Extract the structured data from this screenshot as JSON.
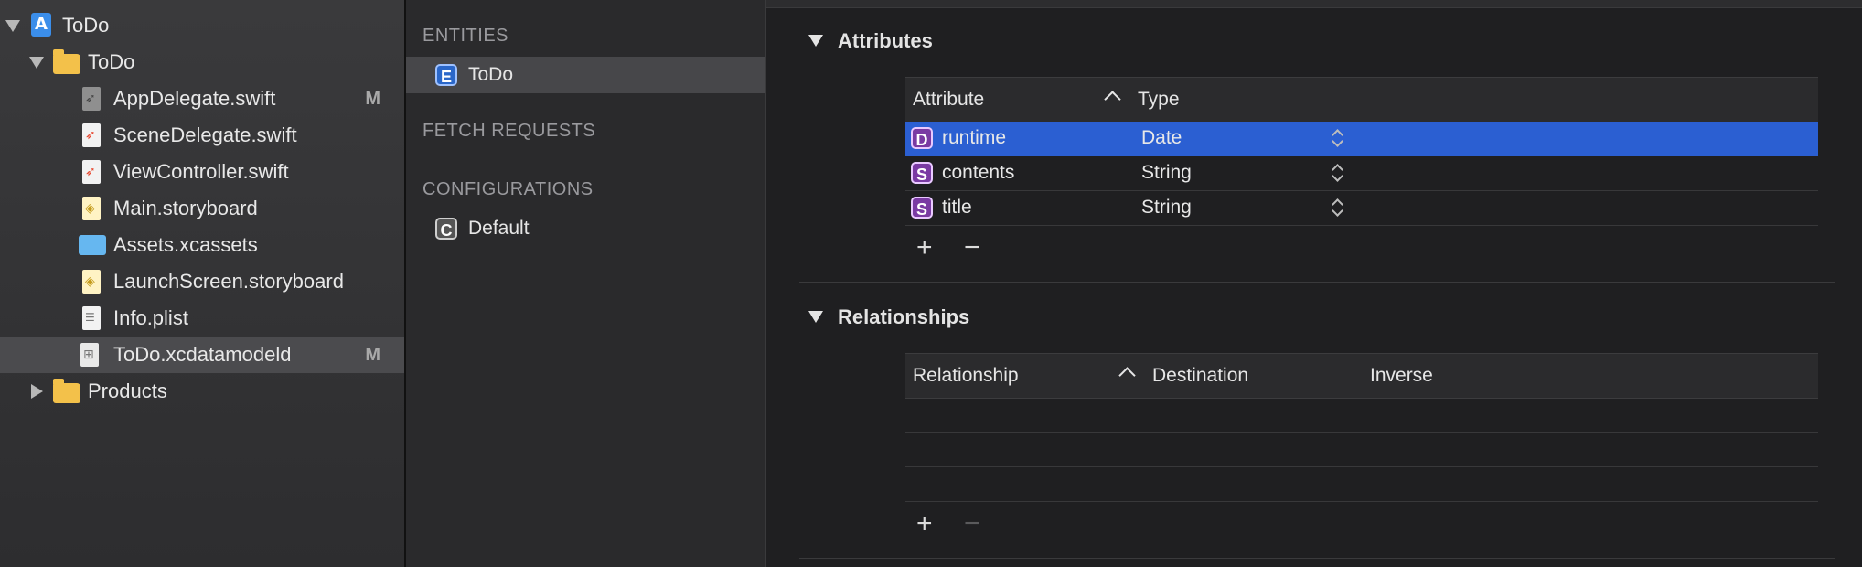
{
  "navigator": {
    "items": [
      {
        "label": "ToDo",
        "badge": "",
        "icon": "project-icon"
      },
      {
        "label": "ToDo",
        "badge": "",
        "icon": "folder-icon"
      },
      {
        "label": "AppDelegate.swift",
        "badge": "M",
        "icon": "swift-file-icon"
      },
      {
        "label": "SceneDelegate.swift",
        "badge": "",
        "icon": "swift-file-icon"
      },
      {
        "label": "ViewController.swift",
        "badge": "",
        "icon": "swift-file-icon"
      },
      {
        "label": "Main.storyboard",
        "badge": "",
        "icon": "storyboard-file-icon"
      },
      {
        "label": "Assets.xcassets",
        "badge": "",
        "icon": "asset-catalog-icon"
      },
      {
        "label": "LaunchScreen.storyboard",
        "badge": "",
        "icon": "storyboard-file-icon"
      },
      {
        "label": "Info.plist",
        "badge": "",
        "icon": "plist-file-icon"
      },
      {
        "label": "ToDo.xcdatamodeld",
        "badge": "M",
        "icon": "datamodel-file-icon"
      },
      {
        "label": "Products",
        "badge": "",
        "icon": "folder-icon"
      }
    ]
  },
  "entity_pane": {
    "entities_header": "ENTITIES",
    "entity": {
      "badge": "E",
      "label": "ToDo"
    },
    "fetch_header": "FETCH REQUESTS",
    "config_header": "CONFIGURATIONS",
    "configuration": {
      "badge": "C",
      "label": "Default"
    }
  },
  "attributes": {
    "title": "Attributes",
    "col_attribute": "Attribute",
    "col_type": "Type",
    "rows": [
      {
        "badge": "D",
        "name": "runtime",
        "type": "Date"
      },
      {
        "badge": "S",
        "name": "contents",
        "type": "String"
      },
      {
        "badge": "S",
        "name": "title",
        "type": "String"
      }
    ],
    "add": "+",
    "remove": "−"
  },
  "relationships": {
    "title": "Relationships",
    "col_relationship": "Relationship",
    "col_destination": "Destination",
    "col_inverse": "Inverse",
    "add": "+",
    "remove": "−"
  },
  "colors": {
    "selection": "#2b5fd2",
    "entity_badge": "#2a67c9",
    "attribute_badge": "#7a3aa3"
  }
}
